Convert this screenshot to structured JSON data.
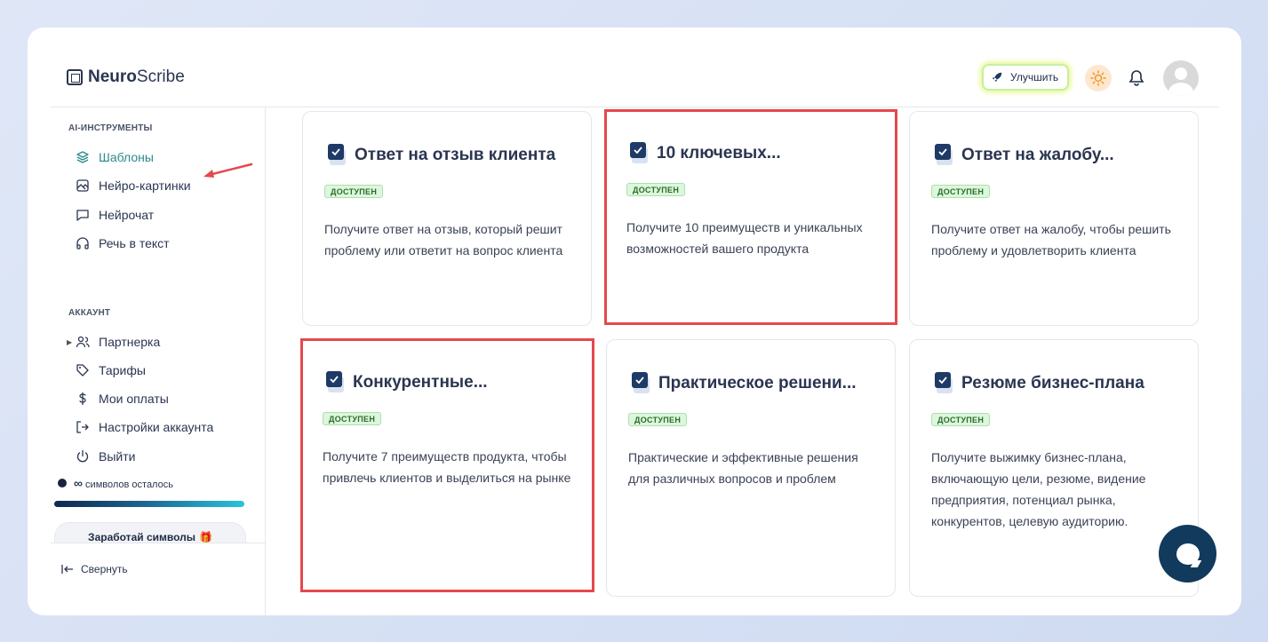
{
  "app": {
    "logo_bold": "Neuro",
    "logo_rest": "Scribe"
  },
  "header": {
    "upgrade_label": "Улучшить"
  },
  "sidebar": {
    "ai_section_title": "AI-ИНСТРУМЕНТЫ",
    "ai_items": [
      {
        "label": "Шаблоны",
        "icon": "layers-icon",
        "active": true
      },
      {
        "label": "Нейро-картинки",
        "icon": "image-icon"
      },
      {
        "label": "Нейрочат",
        "icon": "chat-icon"
      },
      {
        "label": "Речь в текст",
        "icon": "headphones-icon"
      }
    ],
    "account_section_title": "АККАУНТ",
    "account_items": [
      {
        "label": "Партнерка",
        "icon": "users-icon",
        "expandable": true
      },
      {
        "label": "Тарифы",
        "icon": "tag-icon"
      },
      {
        "label": "Мои оплаты",
        "icon": "dollar-icon"
      },
      {
        "label": "Настройки аккаунта",
        "icon": "settings-exit-icon"
      },
      {
        "label": "Выйти",
        "icon": "power-icon"
      }
    ],
    "credits_value": "∞",
    "credits_label": "символов осталось",
    "earn_label": "Заработай символы",
    "collapse_label": "Свернуть"
  },
  "cards": [
    {
      "title": "Ответ на отзыв клиента",
      "badge": "ДОСТУПЕН",
      "description": "Получите ответ на отзыв, который решит проблему или ответит на вопрос клиента",
      "highlighted": false
    },
    {
      "title": "10 ключевых...",
      "badge": "ДОСТУПЕН",
      "description": "Получите 10 преимуществ и уникальных возможностей вашего продукта",
      "highlighted": true
    },
    {
      "title": "Ответ на жалобу...",
      "badge": "ДОСТУПЕН",
      "description": "Получите ответ на жалобу, чтобы решить проблему и удовлетворить клиента",
      "highlighted": false
    },
    {
      "title": "Конкурентные...",
      "badge": "ДОСТУПЕН",
      "description": "Получите 7 преимуществ продукта, чтобы привлечь клиентов и выделиться на рынке",
      "highlighted": true
    },
    {
      "title": "Практическое решени...",
      "badge": "ДОСТУПЕН",
      "description": "Практические и эффективные решения для различных вопросов и проблем",
      "highlighted": false
    },
    {
      "title": "Резюме бизнес-плана",
      "badge": "ДОСТУПЕН",
      "description": "Получите выжимку бизнес-плана, включающую цели, резюме, видение предприятия, потенциал рынка, конкурентов, целевую аудиторию.",
      "highlighted": false
    }
  ],
  "colors": {
    "accent": "#2c8a8a",
    "highlight_border": "#e5484d",
    "brand_dark": "#123a5c",
    "badge_bg": "#dcf7dc"
  }
}
